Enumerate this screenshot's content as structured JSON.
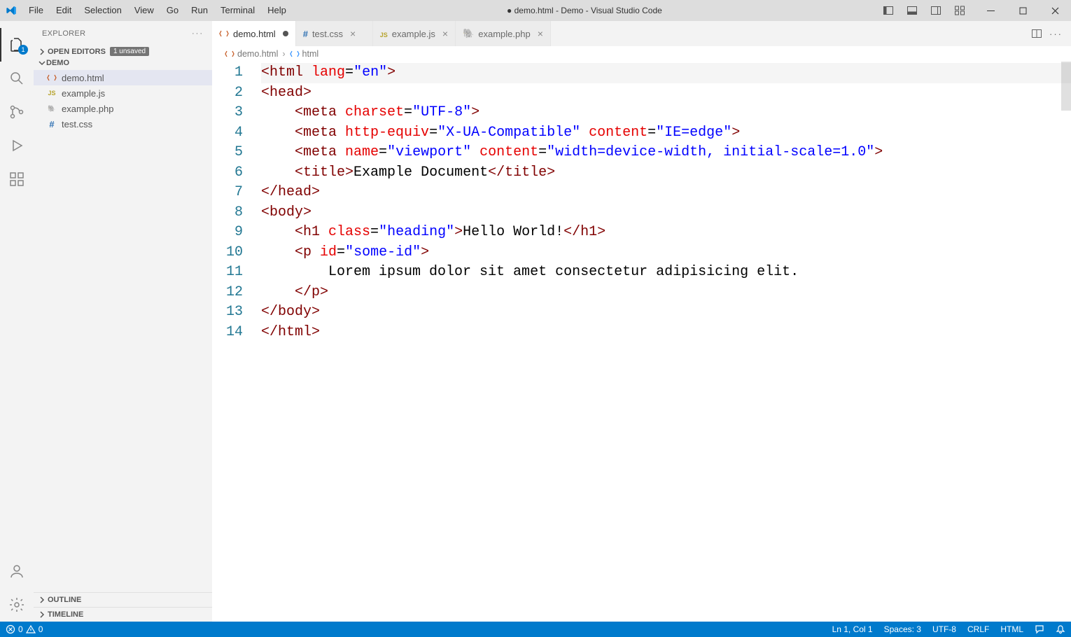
{
  "titlebar": {
    "menu": [
      "File",
      "Edit",
      "Selection",
      "View",
      "Go",
      "Run",
      "Terminal",
      "Help"
    ],
    "title": "● demo.html - Demo - Visual Studio Code"
  },
  "activitybar": {
    "explorer_badge": "1"
  },
  "sidebar": {
    "title": "EXPLORER",
    "open_editors_label": "OPEN EDITORS",
    "unsaved_badge": "1 unsaved",
    "folder_label": "DEMO",
    "files": [
      {
        "name": "demo.html",
        "type": "html"
      },
      {
        "name": "example.js",
        "type": "js"
      },
      {
        "name": "example.php",
        "type": "php"
      },
      {
        "name": "test.css",
        "type": "css"
      }
    ],
    "outline_label": "OUTLINE",
    "timeline_label": "TIMELINE"
  },
  "tabs": [
    {
      "label": "demo.html",
      "type": "html",
      "active": true,
      "dirty": true
    },
    {
      "label": "test.css",
      "type": "css",
      "active": false,
      "dirty": false
    },
    {
      "label": "example.js",
      "type": "js",
      "active": false,
      "dirty": false
    },
    {
      "label": "example.php",
      "type": "php",
      "active": false,
      "dirty": false
    }
  ],
  "breadcrumbs": {
    "file": "demo.html",
    "symbol": "html"
  },
  "editor": {
    "lines": [
      [
        {
          "t": "<",
          "c": "p-punc"
        },
        {
          "t": "html ",
          "c": "p-tag"
        },
        {
          "t": "lang",
          "c": "p-attr"
        },
        {
          "t": "=",
          "c": "p-eq"
        },
        {
          "t": "\"en\"",
          "c": "p-str"
        },
        {
          "t": ">",
          "c": "p-punc"
        }
      ],
      [
        {
          "t": "<",
          "c": "p-punc"
        },
        {
          "t": "head",
          "c": "p-tag"
        },
        {
          "t": ">",
          "c": "p-punc"
        }
      ],
      [
        {
          "t": "    <",
          "c": "p-punc"
        },
        {
          "t": "meta ",
          "c": "p-tag"
        },
        {
          "t": "charset",
          "c": "p-attr"
        },
        {
          "t": "=",
          "c": "p-eq"
        },
        {
          "t": "\"UTF-8\"",
          "c": "p-str"
        },
        {
          "t": ">",
          "c": "p-punc"
        }
      ],
      [
        {
          "t": "    <",
          "c": "p-punc"
        },
        {
          "t": "meta ",
          "c": "p-tag"
        },
        {
          "t": "http-equiv",
          "c": "p-attr"
        },
        {
          "t": "=",
          "c": "p-eq"
        },
        {
          "t": "\"X-UA-Compatible\"",
          "c": "p-str"
        },
        {
          "t": " ",
          "c": "p-text"
        },
        {
          "t": "content",
          "c": "p-attr"
        },
        {
          "t": "=",
          "c": "p-eq"
        },
        {
          "t": "\"IE=edge\"",
          "c": "p-str"
        },
        {
          "t": ">",
          "c": "p-punc"
        }
      ],
      [
        {
          "t": "    <",
          "c": "p-punc"
        },
        {
          "t": "meta ",
          "c": "p-tag"
        },
        {
          "t": "name",
          "c": "p-attr"
        },
        {
          "t": "=",
          "c": "p-eq"
        },
        {
          "t": "\"viewport\"",
          "c": "p-str"
        },
        {
          "t": " ",
          "c": "p-text"
        },
        {
          "t": "content",
          "c": "p-attr"
        },
        {
          "t": "=",
          "c": "p-eq"
        },
        {
          "t": "\"width=device-width, initial-scale=1.0\"",
          "c": "p-str"
        },
        {
          "t": ">",
          "c": "p-punc"
        }
      ],
      [
        {
          "t": "    <",
          "c": "p-punc"
        },
        {
          "t": "title",
          "c": "p-tag"
        },
        {
          "t": ">",
          "c": "p-punc"
        },
        {
          "t": "Example Document",
          "c": "p-text"
        },
        {
          "t": "</",
          "c": "p-punc"
        },
        {
          "t": "title",
          "c": "p-tag"
        },
        {
          "t": ">",
          "c": "p-punc"
        }
      ],
      [
        {
          "t": "</",
          "c": "p-punc"
        },
        {
          "t": "head",
          "c": "p-tag"
        },
        {
          "t": ">",
          "c": "p-punc"
        }
      ],
      [
        {
          "t": "<",
          "c": "p-punc"
        },
        {
          "t": "body",
          "c": "p-tag"
        },
        {
          "t": ">",
          "c": "p-punc"
        }
      ],
      [
        {
          "t": "    <",
          "c": "p-punc"
        },
        {
          "t": "h1 ",
          "c": "p-tag"
        },
        {
          "t": "class",
          "c": "p-attr"
        },
        {
          "t": "=",
          "c": "p-eq"
        },
        {
          "t": "\"heading\"",
          "c": "p-str"
        },
        {
          "t": ">",
          "c": "p-punc"
        },
        {
          "t": "Hello World!",
          "c": "p-text"
        },
        {
          "t": "</",
          "c": "p-punc"
        },
        {
          "t": "h1",
          "c": "p-tag"
        },
        {
          "t": ">",
          "c": "p-punc"
        }
      ],
      [
        {
          "t": "    <",
          "c": "p-punc"
        },
        {
          "t": "p ",
          "c": "p-tag"
        },
        {
          "t": "id",
          "c": "p-attr"
        },
        {
          "t": "=",
          "c": "p-eq"
        },
        {
          "t": "\"some-id\"",
          "c": "p-str"
        },
        {
          "t": ">",
          "c": "p-punc"
        }
      ],
      [
        {
          "t": "        Lorem ipsum dolor sit amet consectetur adipisicing elit.",
          "c": "p-text"
        }
      ],
      [
        {
          "t": "    </",
          "c": "p-punc"
        },
        {
          "t": "p",
          "c": "p-tag"
        },
        {
          "t": ">",
          "c": "p-punc"
        }
      ],
      [
        {
          "t": "</",
          "c": "p-punc"
        },
        {
          "t": "body",
          "c": "p-tag"
        },
        {
          "t": ">",
          "c": "p-punc"
        }
      ],
      [
        {
          "t": "</",
          "c": "p-punc"
        },
        {
          "t": "html",
          "c": "p-tag"
        },
        {
          "t": ">",
          "c": "p-punc"
        }
      ]
    ]
  },
  "statusbar": {
    "errors": "0",
    "warnings": "0",
    "position": "Ln 1, Col 1",
    "spaces": "Spaces: 3",
    "encoding": "UTF-8",
    "eol": "CRLF",
    "language": "HTML"
  }
}
